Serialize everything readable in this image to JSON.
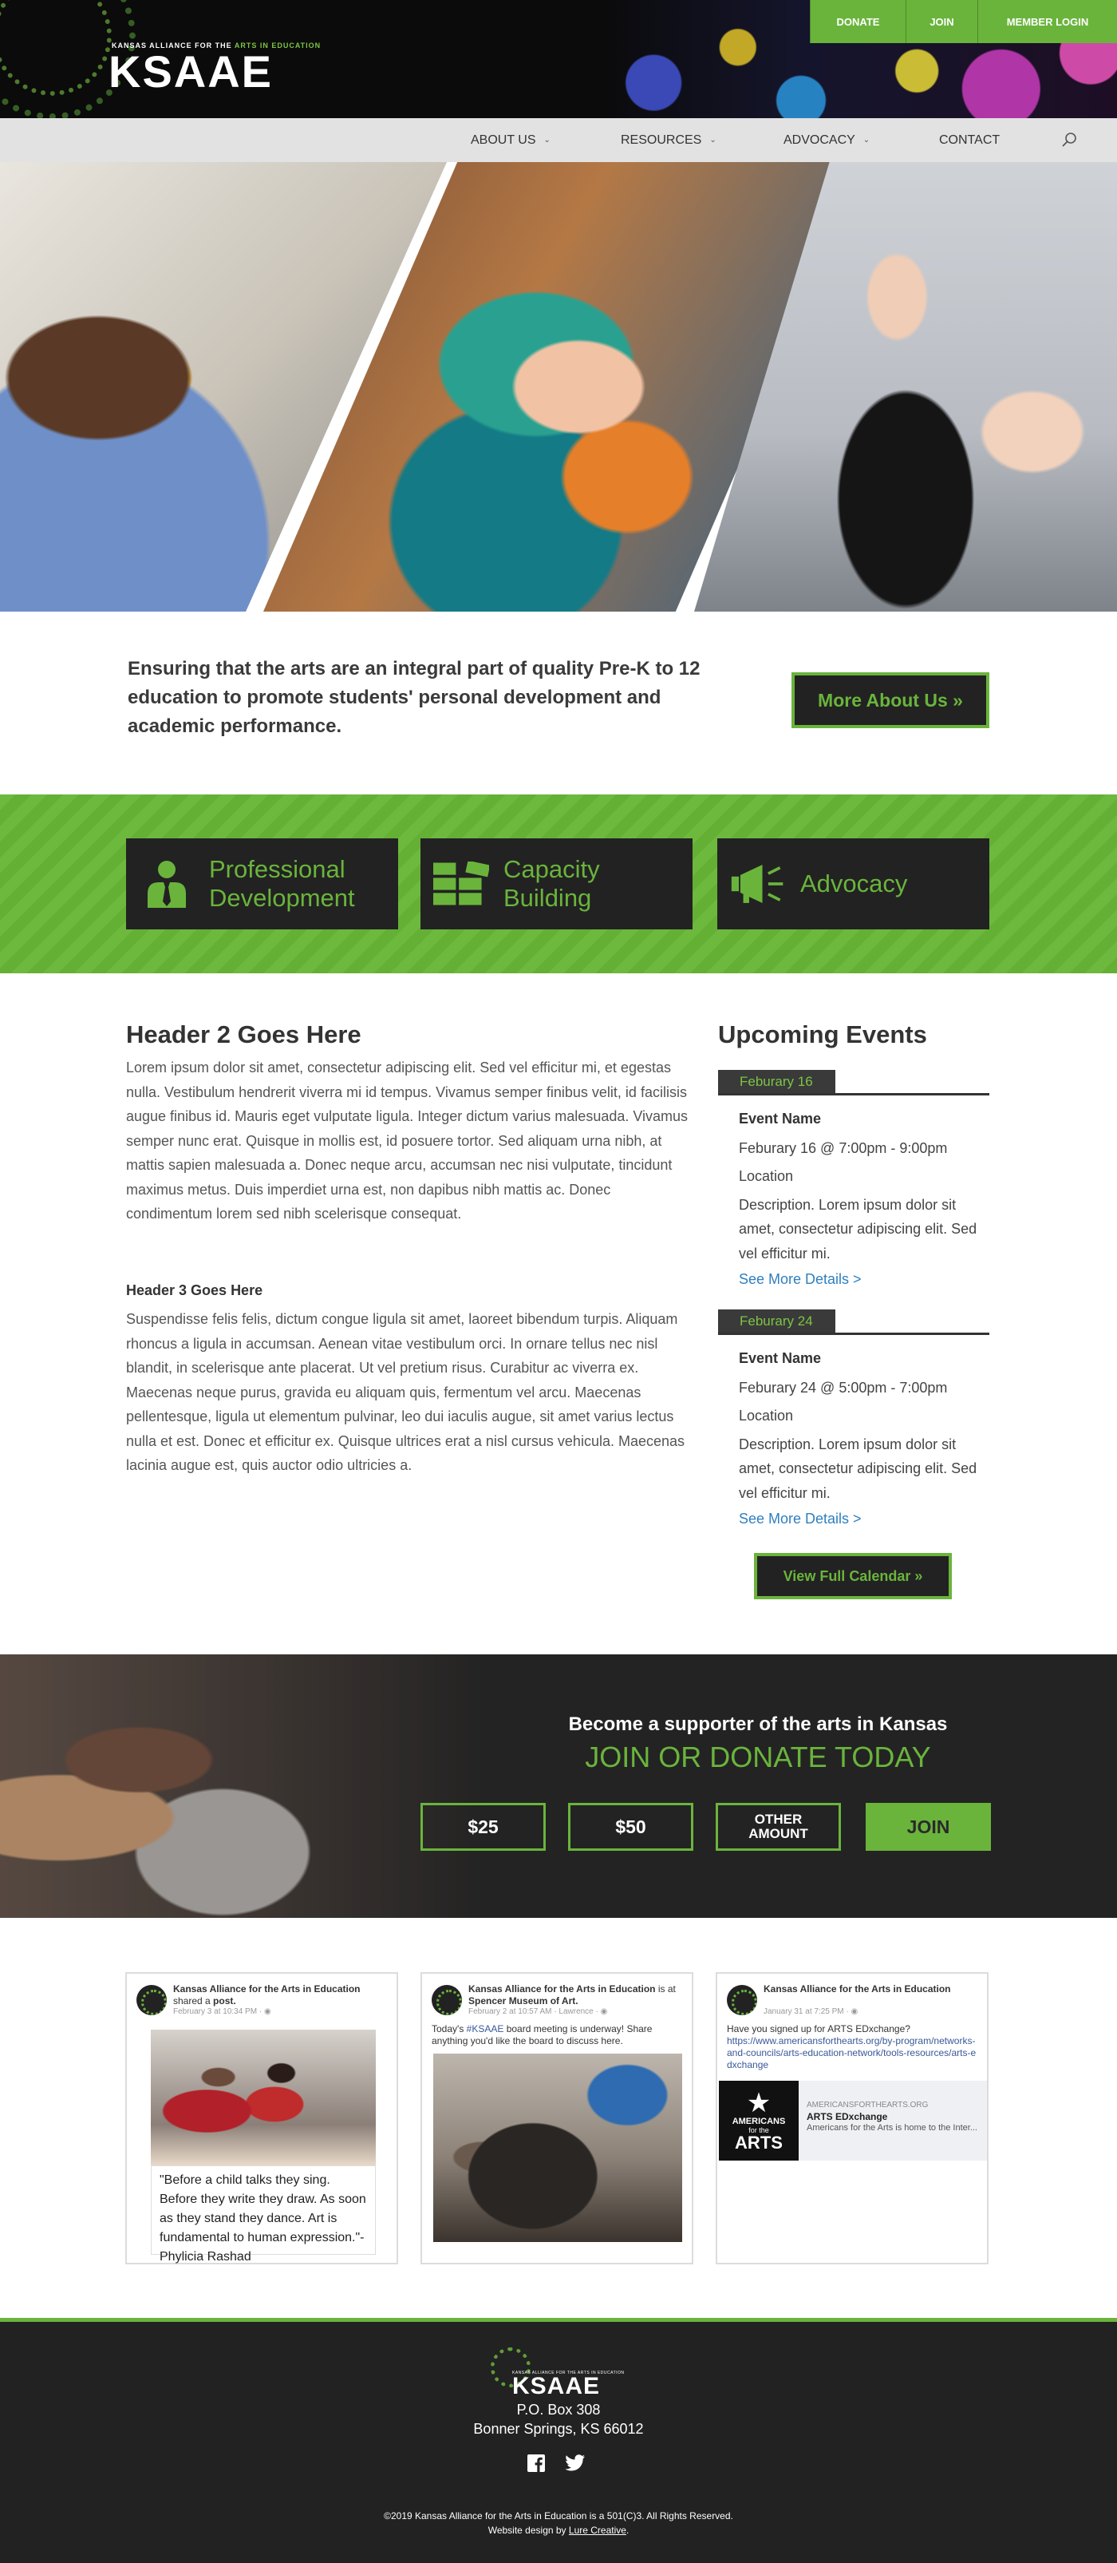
{
  "header": {
    "logo_small_a": "KANSAS ALLIANCE FOR THE",
    "logo_small_b": "ARTS IN EDUCATION",
    "logo": "KSAAE",
    "utility": {
      "donate": "DONATE",
      "join": "JOIN",
      "login": "MEMBER LOGIN"
    },
    "nav": [
      {
        "label": "ABOUT US"
      },
      {
        "label": "RESOURCES"
      },
      {
        "label": "ADVOCACY"
      },
      {
        "label": "CONTACT"
      }
    ]
  },
  "mission": {
    "text": "Ensuring that the arts are an integral part of quality Pre-K to 12 education to promote students' personal development and academic performance.",
    "button": "More About Us »"
  },
  "features": [
    {
      "line1": "Professional",
      "line2": "Development",
      "icon": "person-tie-icon"
    },
    {
      "line1": "Capacity",
      "line2": "Building",
      "icon": "bricks-icon"
    },
    {
      "line1": "Advocacy",
      "line2": "",
      "icon": "megaphone-icon"
    }
  ],
  "content": {
    "h2": "Header 2 Goes Here",
    "p1": "Lorem ipsum dolor sit amet, consectetur adipiscing elit. Sed vel efficitur mi, et egestas nulla. Vestibulum hendrerit viverra mi id tempus. Vivamus semper finibus velit, id facilisis augue finibus id. Mauris eget vulputate ligula. Integer dictum varius malesuada. Vivamus semper nunc erat. Quisque in mollis est, id posuere tortor. Sed aliquam urna nibh, at mattis sapien malesuada a. Donec neque arcu, accumsan nec nisi vulputate, tincidunt maximus metus. Duis imperdiet urna est, non dapibus nibh mattis ac. Donec condimentum lorem sed nibh scelerisque consequat.",
    "h3": "Header 3 Goes Here",
    "p2": "Suspendisse felis felis, dictum congue ligula sit amet, laoreet bibendum turpis. Aliquam rhoncus a ligula in accumsan. Aenean vitae vestibulum orci. In ornare tellus nec nisl blandit, in scelerisque ante placerat. Ut vel pretium risus. Curabitur ac viverra ex. Maecenas neque purus, gravida eu aliquam quis, fermentum vel arcu. Maecenas pellentesque, ligula ut elementum pulvinar, leo dui iaculis augue, sit amet varius lectus nulla et est. Donec et efficitur ex. Quisque ultrices erat a nisl cursus vehicula. Maecenas lacinia augue est, quis auctor odio ultricies a."
  },
  "events": {
    "heading": "Upcoming Events",
    "items": [
      {
        "date": "Feburary 16",
        "name": "Event Name",
        "time": "Feburary 16 @ 7:00pm - 9:00pm",
        "location": "Location",
        "desc": "Description. Lorem ipsum dolor sit amet, consectetur adipiscing elit. Sed vel efficitur mi.",
        "link": "See More Details >"
      },
      {
        "date": "Feburary 24",
        "name": "Event Name",
        "time": "Feburary 24 @ 5:00pm - 7:00pm",
        "location": "Location",
        "desc": "Description. Lorem ipsum dolor sit amet, consectetur adipiscing elit. Sed vel efficitur mi.",
        "link": "See More Details >"
      }
    ],
    "calendar_button": "View Full Calendar »"
  },
  "support": {
    "title": "Become a supporter of the arts in Kansas",
    "subtitle": "JOIN OR DONATE TODAY",
    "amounts": [
      "$25",
      "$50"
    ],
    "other_1": "OTHER",
    "other_2": "AMOUNT",
    "join": "JOIN"
  },
  "social": [
    {
      "name": "Kansas Alliance for the Arts in Education",
      "action_pre": "shared a ",
      "action_obj": "post",
      "meta": "February 3 at 10:34 PM · ◉",
      "quote": "\"Before a child talks they sing. Before they write they draw. As soon as they stand they dance. Art is fundamental to human expression.\"-Phylicia Rashad"
    },
    {
      "name": "Kansas Alliance for the Arts in Education",
      "action_pre": "is at ",
      "action_obj": "Spencer Museum of Art",
      "meta": "February 2 at 10:57 AM · Lawrence · ◉",
      "body_pre": "Today's ",
      "body_tag": "#KSAAE",
      "body_post": " board meeting is underway! Share anything you'd like the board to discuss here."
    },
    {
      "name": "Kansas Alliance for the Arts in Education",
      "meta": "January 31 at 7:25 PM · ◉",
      "body": "Have you signed up for ARTS EDxchange?",
      "url": "https://www.americansforthearts.org/by-program/networks-and-councils/arts-education-network/tools-resources/arts-edxchange",
      "link_domain": "AMERICANSFORTHEARTS.ORG",
      "link_title": "ARTS EDxchange",
      "link_desc": "Americans for the Arts is home to the Inter...",
      "logo_l1": "AMERICANS",
      "logo_l1b": "for the",
      "logo_l2": "ARTS"
    }
  ],
  "footer": {
    "logo_small": "KANSAS ALLIANCE FOR THE ARTS IN EDUCATION",
    "logo": "KSAAE",
    "address1": "P.O. Box 308",
    "address2": "Bonner Springs, KS 66012",
    "copyright": "©2019 Kansas Alliance for the Arts in Education is a 501(C)3. All Rights Reserved.",
    "credit_pre": "Website design by ",
    "credit_link": "Lure Creative",
    "credit_post": "."
  },
  "colors": {
    "accent": "#6ab43c",
    "dark": "#222222",
    "link": "#2f7fbf"
  }
}
